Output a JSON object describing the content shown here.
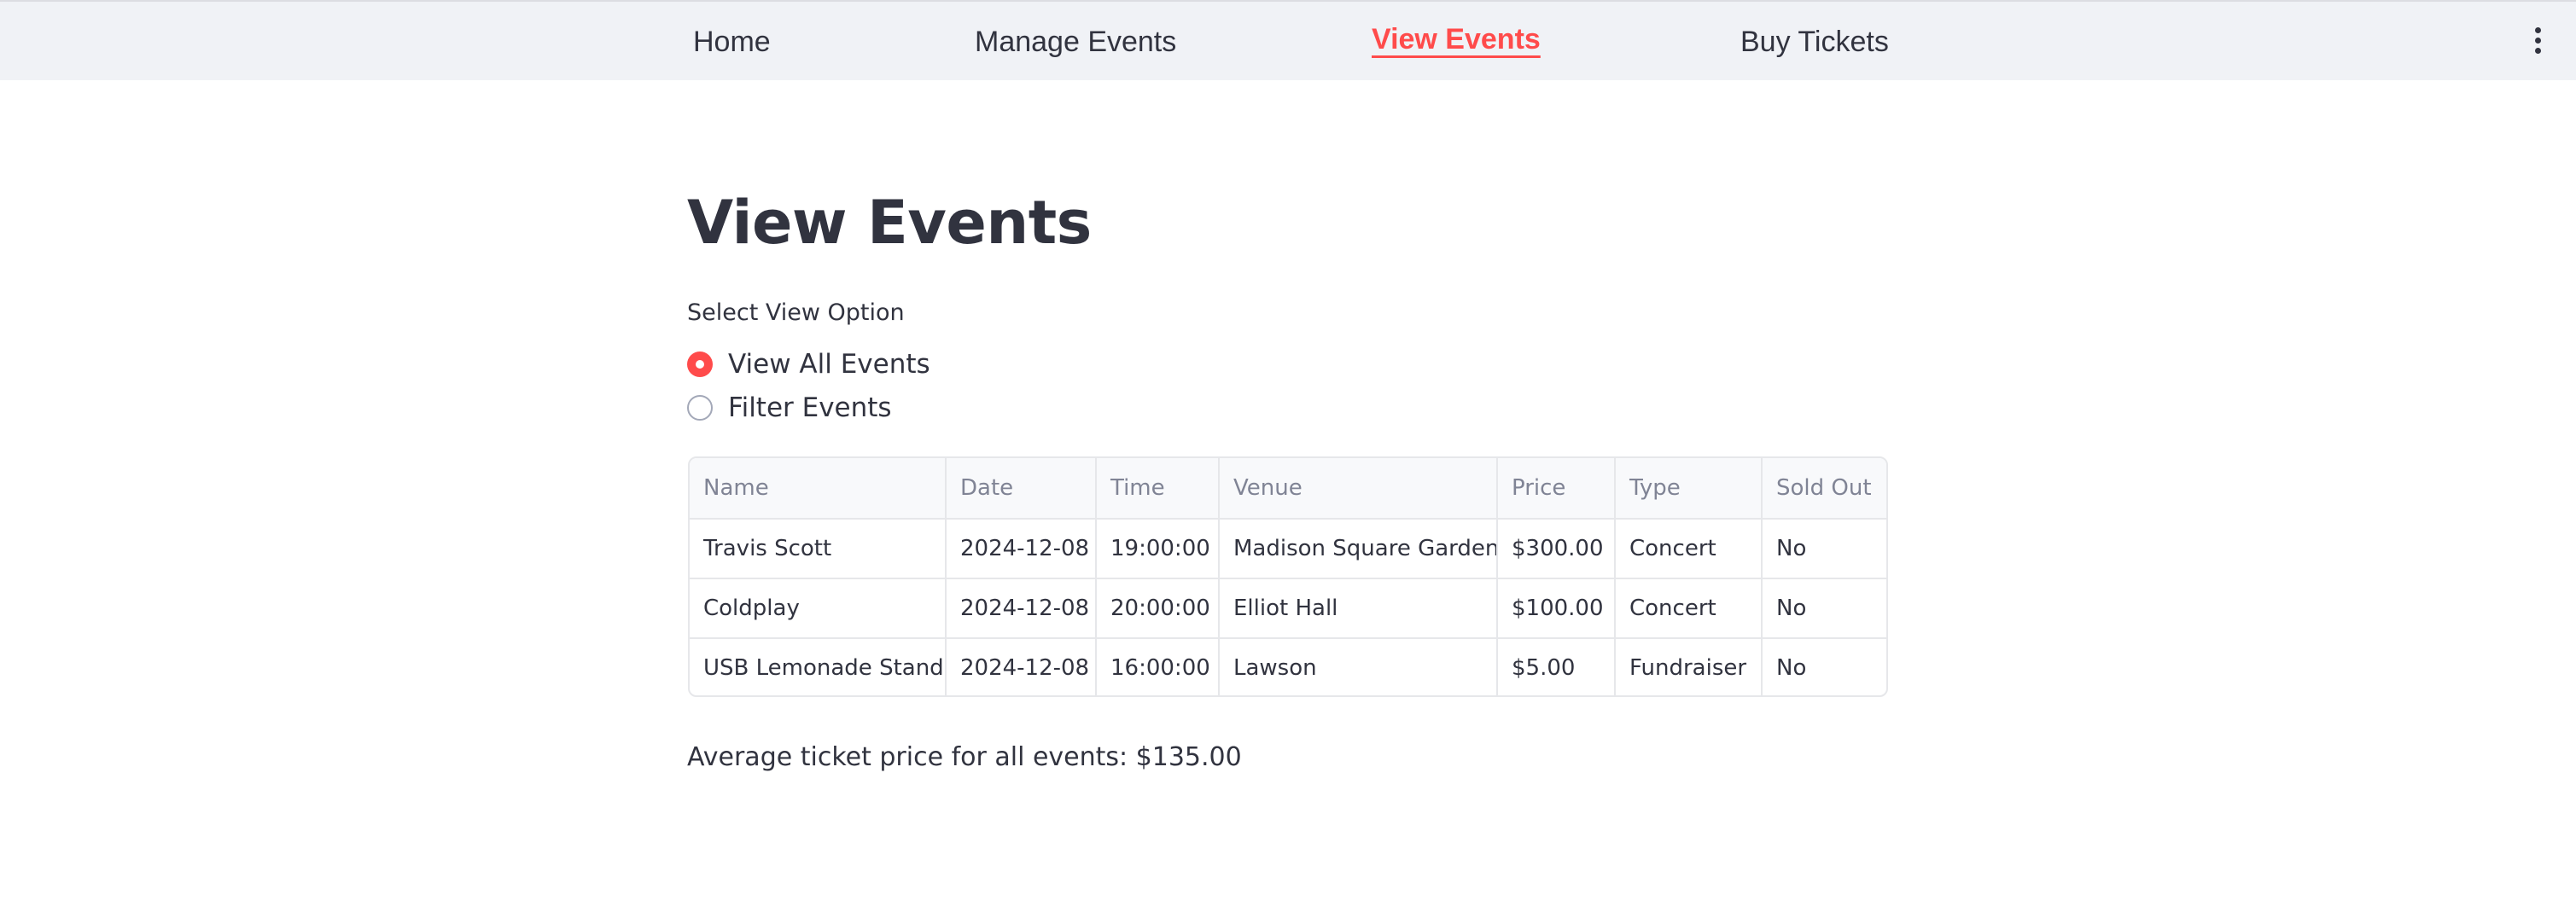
{
  "nav": {
    "items": [
      {
        "label": "Home",
        "active": false
      },
      {
        "label": "Manage Events",
        "active": false
      },
      {
        "label": "View Events",
        "active": true
      },
      {
        "label": "Buy Tickets",
        "active": false
      }
    ],
    "menu_icon": "kebab-menu-icon"
  },
  "colors": {
    "accent": "#ff4b4b",
    "nav_background": "#f0f2f6",
    "text": "#31333f",
    "header_text": "#808495"
  },
  "page": {
    "title": "View Events"
  },
  "view_option": {
    "label": "Select View Option",
    "options": [
      {
        "label": "View All Events",
        "selected": true
      },
      {
        "label": "Filter Events",
        "selected": false
      }
    ]
  },
  "events_table": {
    "columns": [
      "Name",
      "Date",
      "Time",
      "Venue",
      "Price",
      "Type",
      "Sold Out"
    ],
    "rows": [
      [
        "Travis Scott",
        "2024-12-08",
        "19:00:00",
        "Madison Square Garden",
        "$300.00",
        "Concert",
        "No"
      ],
      [
        "Coldplay",
        "2024-12-08",
        "20:00:00",
        "Elliot Hall",
        "$100.00",
        "Concert",
        "No"
      ],
      [
        "USB Lemonade Stand",
        "2024-12-08",
        "16:00:00",
        "Lawson",
        "$5.00",
        "Fundraiser",
        "No"
      ]
    ]
  },
  "summary": {
    "average_text": "Average ticket price for all events: $135.00"
  }
}
